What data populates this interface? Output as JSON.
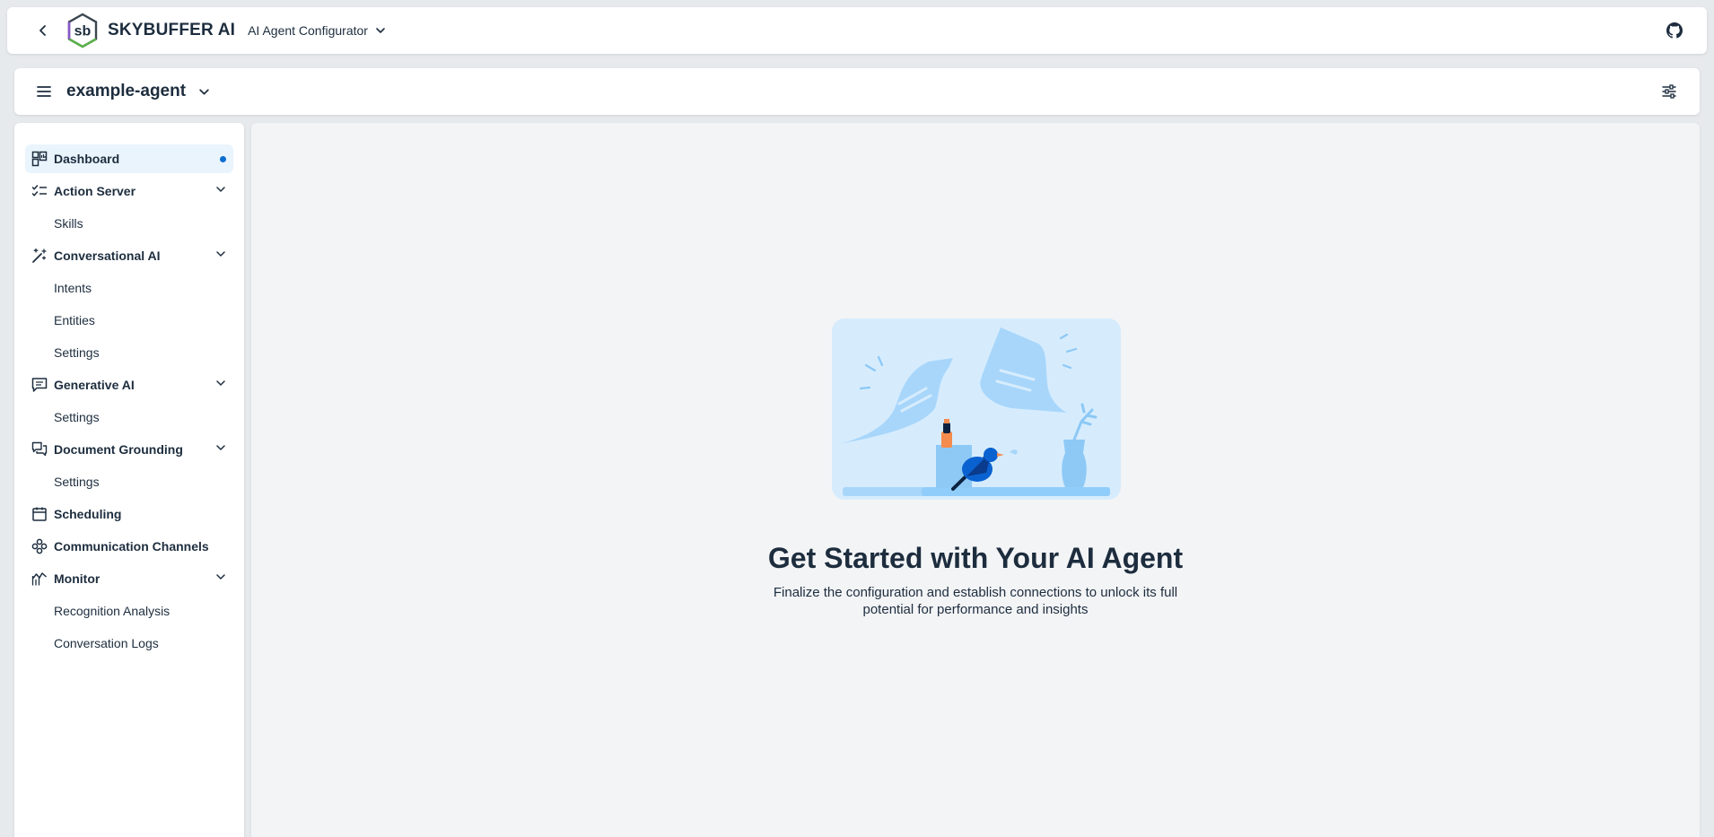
{
  "shellbar": {
    "brand": "SKYBUFFER AI",
    "logo_text": "sb",
    "product": "AI Agent Configurator"
  },
  "header": {
    "agent_name": "example-agent"
  },
  "sidebar": {
    "items": [
      {
        "label": "Dashboard",
        "icon": "dashboard-icon",
        "level": "top",
        "selected": true
      },
      {
        "label": "Action Server",
        "icon": "checklist-icon",
        "level": "top",
        "expandable": true
      },
      {
        "label": "Skills",
        "level": "sub"
      },
      {
        "label": "Conversational AI",
        "icon": "magic-wand-icon",
        "level": "top",
        "expandable": true
      },
      {
        "label": "Intents",
        "level": "sub"
      },
      {
        "label": "Entities",
        "level": "sub"
      },
      {
        "label": "Settings",
        "level": "sub"
      },
      {
        "label": "Generative AI",
        "icon": "chat-icon",
        "level": "top",
        "expandable": true
      },
      {
        "label": "Settings",
        "level": "sub"
      },
      {
        "label": "Document Grounding",
        "icon": "discussion-icon",
        "level": "top",
        "expandable": true
      },
      {
        "label": "Settings",
        "level": "sub"
      },
      {
        "label": "Scheduling",
        "icon": "calendar-icon",
        "level": "top"
      },
      {
        "label": "Communication Channels",
        "icon": "network-icon",
        "level": "top"
      },
      {
        "label": "Monitor",
        "icon": "line-chart-icon",
        "level": "top",
        "expandable": true
      },
      {
        "label": "Recognition Analysis",
        "level": "sub"
      },
      {
        "label": "Conversation Logs",
        "level": "sub"
      }
    ]
  },
  "main": {
    "title": "Get Started with Your AI Agent",
    "description": "Finalize the configuration and establish connections to unlock its full potential for performance and insights"
  },
  "colors": {
    "accent": "#0a6ed1",
    "selected_bg": "#eaf4fd",
    "illustration_bg": "#d6ecfd"
  }
}
